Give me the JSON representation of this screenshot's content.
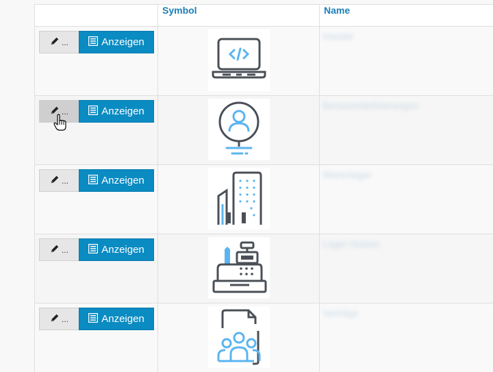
{
  "headers": {
    "actions": "",
    "symbol": "Symbol",
    "name": "Name"
  },
  "buttons": {
    "edit_label": "...",
    "show_label": "Anzeigen"
  },
  "rows": [
    {
      "icon": "laptop-code-icon",
      "name": "Handel"
    },
    {
      "icon": "user-profile-icon",
      "name": "Benutzerdefinierungen"
    },
    {
      "icon": "office-buildings-icon",
      "name": "Warenlager"
    },
    {
      "icon": "cash-register-icon",
      "name": "Lager-Station"
    },
    {
      "icon": "team-document-icon",
      "name": "Verträge"
    }
  ],
  "colors": {
    "accent": "#0a8bc2",
    "header_text": "#1b7fb8",
    "icon_dark": "#4a4f57",
    "icon_light": "#5ab4f0"
  }
}
